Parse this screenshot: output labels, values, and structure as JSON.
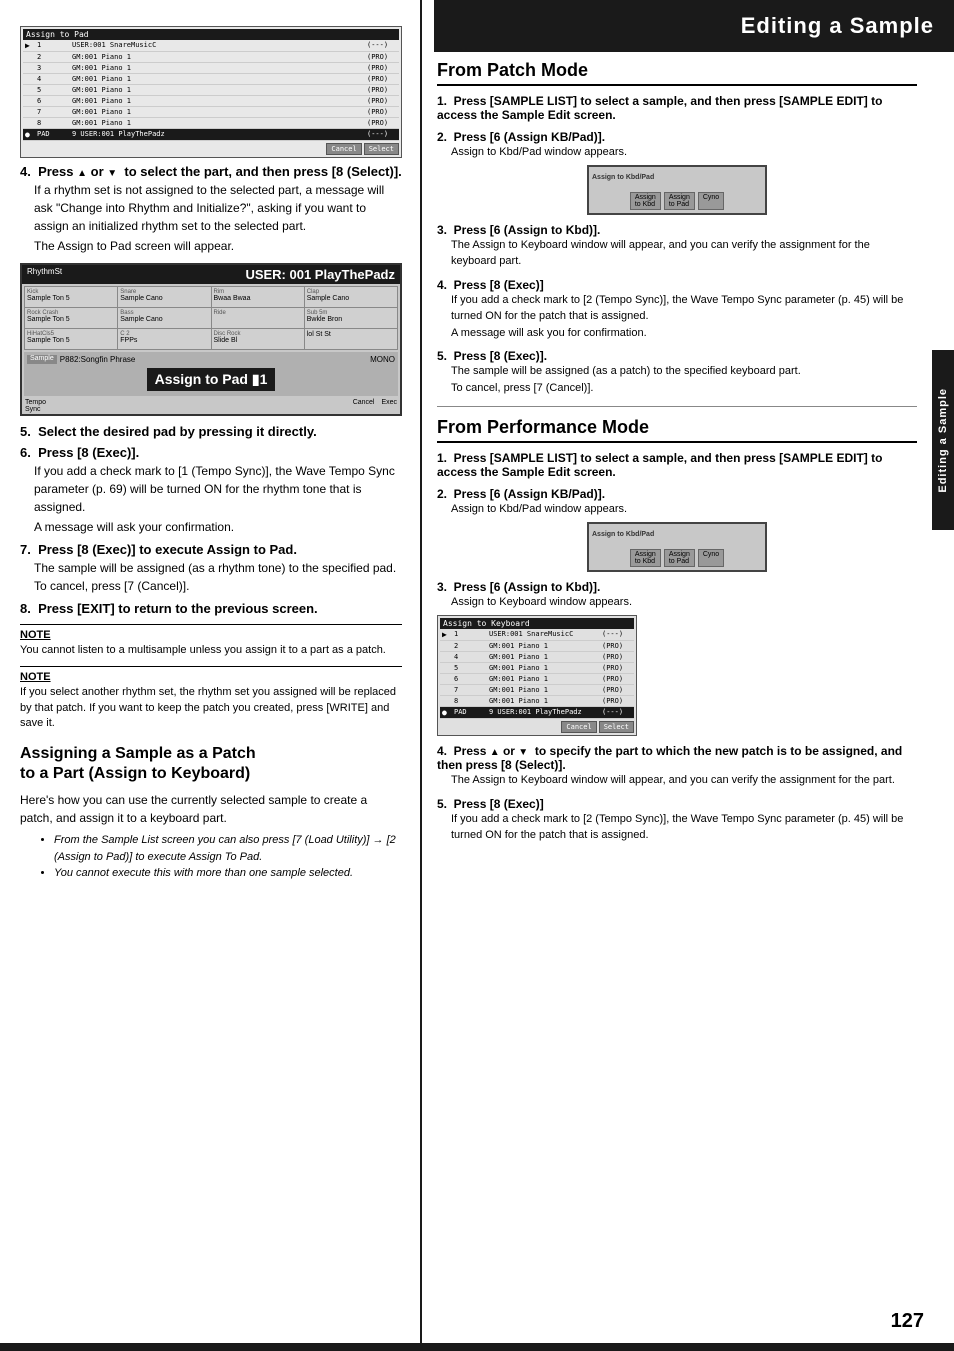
{
  "header": {
    "title": "Editing a Sample"
  },
  "sidebar_tab": "Editing a Sample",
  "page_number": "127",
  "left_col": {
    "screen1": {
      "title": "Assign to Pad",
      "rows": [
        {
          "num": "▶",
          "id": "1",
          "name": "USER:001 SnareMusicC",
          "val": "(---)"
        },
        {
          "num": "",
          "id": "2",
          "name": "GM:001 Piano 1",
          "val": "(PRO)"
        },
        {
          "num": "",
          "id": "3",
          "name": "GM:001 Piano 1",
          "val": "(PRO)"
        },
        {
          "num": "",
          "id": "4",
          "name": "GM:001 Piano 1",
          "val": "(PRO)"
        },
        {
          "num": "",
          "id": "5",
          "name": "GM:001 Piano 1",
          "val": "(PRO)"
        },
        {
          "num": "",
          "id": "6",
          "name": "GM:001 Piano 1",
          "val": "(PRO)"
        },
        {
          "num": "",
          "id": "7",
          "name": "GM:001 Piano 1",
          "val": "(PRO)"
        },
        {
          "num": "",
          "id": "8",
          "name": "GM:001 Piano 1",
          "val": "(PRO)"
        },
        {
          "num": "●",
          "id": "PAD",
          "name": "9 USER:001 PlayThePadz",
          "val": "(---)"
        }
      ],
      "buttons": [
        "Cancel",
        "Select"
      ]
    },
    "step4": {
      "label": "4.",
      "text": "Press ▲ or ▼  to select the part, and then press [8 (Select)].",
      "detail": "If a rhythm set is not assigned to the selected part, a message will ask \"Change into Rhythm and Initialize?\", asking if you want to assign an initialized rhythm set to the selected part.",
      "note": "The Assign to Pad screen will appear."
    },
    "assign_pad_screen": {
      "header_left": "RhythmSt",
      "title": "USER: 001 PlayThePadz",
      "cells": [
        {
          "label": "Kick",
          "val": "Sample Ton 5",
          "extra": ""
        },
        {
          "label": "Snare",
          "val": "Sample Cano",
          "extra": ""
        },
        {
          "label": "Rim",
          "val": "Bwaa Bwaa",
          "extra": ""
        },
        {
          "label": "Clap",
          "val": "Sample Cano",
          "extra": ""
        },
        {
          "label": "Rock Crash",
          "val": "Sample Ton 5",
          "extra": ""
        },
        {
          "label": "Bass",
          "val": "Sample Cano",
          "extra": ""
        },
        {
          "label": "Ride",
          "val": "",
          "extra": ""
        },
        {
          "label": "Sub 5m",
          "val": "Bwkle Bron",
          "extra": ""
        },
        {
          "label": "HiHatCls5",
          "val": "Sample Ton 5",
          "extra": ""
        },
        {
          "label": "C 2",
          "val": "FPPs",
          "extra": ""
        },
        {
          "label": "Disc Rock",
          "val": "Slide Bl",
          "extra": ""
        },
        {
          "label": "",
          "val": "lol St St",
          "extra": ""
        }
      ],
      "sample_label": "Sample",
      "sample_val": "P882:Songfin Phrase",
      "mono_label": "MONO",
      "assign_text": "Assign to Pad  1",
      "footer_left": "Tempo Sync",
      "footer_right": "Cancel  Exec"
    },
    "step5": "5.  Select the desired pad by pressing it directly.",
    "step6": {
      "label": "6.",
      "text": "Press [8 (Exec)].",
      "detail": "If you add a check mark to [1 (Tempo Sync)], the Wave Tempo Sync parameter (p. 69) will be turned ON for the rhythm tone that is assigned.",
      "note": "A message will ask your confirmation."
    },
    "step7": {
      "label": "7.",
      "text": "Press [8 (Exec)] to execute Assign to Pad.",
      "detail": "The sample will be assigned (as a rhythm tone) to the specified pad. To cancel, press [7 (Cancel)]."
    },
    "step8": {
      "label": "8.",
      "text": "Press [EXIT] to return to the previous screen."
    },
    "note1": {
      "title": "NOTE",
      "text": "You cannot listen to a multisample unless you assign it to a part as a patch."
    },
    "note2": {
      "title": "NOTE",
      "text": "If you select another rhythm set, the rhythm set you assigned will be replaced by that patch. If you want to keep the patch you created, press [WRITE] and save it."
    },
    "assign_section": {
      "title": "Assigning a Sample as a Patch to a Part (Assign to Keyboard)",
      "intro": "Here's how you can use the currently selected sample to create a patch, and assign it to a keyboard part.",
      "bullets": [
        "From the Sample List screen you can also press [7 (Load Utility)] → [2 (Assign to Pad)] to execute Assign To Pad.",
        "You cannot execute this with more than one sample selected."
      ]
    }
  },
  "right_col": {
    "from_patch": {
      "title": "From Patch Mode",
      "steps": [
        {
          "num": "1.",
          "text": "Press [SAMPLE LIST] to select a sample, and then press [SAMPLE EDIT] to access the Sample Edit screen."
        },
        {
          "num": "2.",
          "text": "Press [6 (Assign KB/Pad)].",
          "note": "Assign to Kbd/Pad window appears."
        },
        {
          "num": "3.",
          "text": "Press [6 (Assign to Kbd)].",
          "note": "The Assign to Keyboard window will appear, and you can verify the assignment for the keyboard part."
        },
        {
          "num": "4.",
          "text": "Press [8 (Exec)]",
          "note": "If you add a check mark to [2 (Tempo Sync)], the Wave Tempo Sync parameter (p. 45) will be turned ON for the patch that is assigned.",
          "note2": "A message will ask you for confirmation."
        },
        {
          "num": "5.",
          "text": "Press [8 (Exec)].",
          "note": "The sample will be assigned (as a patch) to the specified keyboard part.",
          "note2": "To cancel, press [7 (Cancel)]."
        }
      ]
    },
    "from_performance": {
      "title": "From Performance Mode",
      "steps": [
        {
          "num": "1.",
          "text": "Press [SAMPLE LIST] to select a sample, and then press [SAMPLE EDIT] to access the Sample Edit screen."
        },
        {
          "num": "2.",
          "text": "Press [6 (Assign KB/Pad)].",
          "note": "Assign to Kbd/Pad window appears."
        },
        {
          "num": "3.",
          "text": "Press [6 (Assign to Kbd)].",
          "note": "Assign to Keyboard window appears."
        },
        {
          "num": "4.",
          "text": "Press ▲ or ▼  to specify the part to which the new patch is to be assigned, and then press [8 (Select)].",
          "note": "The Assign to Keyboard window will appear, and you can verify the assignment for the part."
        },
        {
          "num": "5.",
          "text": "Press [8 (Exec)]",
          "note": "If you add a check mark to [2 (Tempo Sync)], the Wave Tempo Sync parameter (p. 45) will be turned ON for the patch that is assigned."
        }
      ]
    },
    "assign_kbd_screen": {
      "title": "Assign to Keyboard",
      "rows": [
        {
          "id": "▶",
          "num": "1",
          "name": "USER:001 SnareMusicC",
          "val": "(---)"
        },
        {
          "id": "",
          "num": "2",
          "name": "GM:001 Piano 1",
          "val": "(PRO)"
        },
        {
          "id": "",
          "num": "4",
          "name": "GM:001 Piano 1",
          "val": "(PRO)"
        },
        {
          "id": "",
          "num": "5",
          "name": "GM:001 Piano 1",
          "val": "(PRO)"
        },
        {
          "id": "",
          "num": "6",
          "name": "GM:001 Piano 1",
          "val": "(PRO)"
        },
        {
          "id": "",
          "num": "7",
          "name": "GM:001 Piano 1",
          "val": "(PRO)"
        },
        {
          "id": "",
          "num": "8",
          "name": "GM:001 Piano 1",
          "val": "(PRO)"
        },
        {
          "id": "●",
          "num": "PAD",
          "name": "9 USER:001 PlayThePadz",
          "val": "(---)"
        }
      ],
      "buttons": [
        "Cancel",
        "Select"
      ]
    }
  }
}
